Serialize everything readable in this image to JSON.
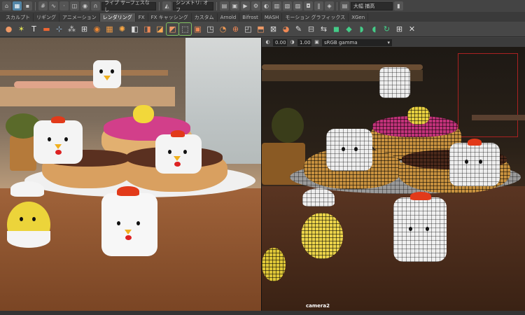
{
  "statusline": {
    "camera_dropdown": "ライブ サーフェスなし",
    "symmetry_dropdown": "シンメトリ: オフ",
    "render_dropdown": "大幅 捕高"
  },
  "shelf_tabs": [
    "スカルプト",
    "リギング",
    "アニメーション",
    "レンダリング",
    "FX",
    "FX キャッシング",
    "カスタム",
    "Arnold",
    "Bifrost",
    "MASH",
    "モーション グラフィックス",
    "XGen"
  ],
  "active_shelf_tab": 3,
  "viewport_bar": {
    "exposure_value": "0.00",
    "gamma_value": "1.00",
    "color_space": "sRGB gamma"
  },
  "viewport": {
    "camera_name": "camera2"
  },
  "colors": {
    "ui_bg": "#444444",
    "active_blue": "#5285a6",
    "icon_highlight": "#7fbf5f"
  },
  "shelf_icons": [
    "sphere-icon",
    "asterisk-icon",
    "text-icon",
    "image-icon",
    "pivot-icon",
    "cluster-icon",
    "uv-icon",
    "render-icon",
    "sphere-grid-icon",
    "sun-icon",
    "cube-icon",
    "lights-icon",
    "shader-icon",
    "hypershade-icon",
    "capsule-icon",
    "boxes-icon",
    "cube-stack-icon",
    "sphere-tex-icon",
    "sphere-net-icon",
    "cube-grey-icon",
    "box-frame-icon",
    "x-box-icon",
    "brush-icon",
    "chart-icon",
    "toggle-icon",
    "green-cube-icon",
    "green-box2-icon",
    "green-box3-icon",
    "green-box4-icon",
    "green-arrow-icon",
    "green-grid-icon",
    "green-x-icon"
  ]
}
